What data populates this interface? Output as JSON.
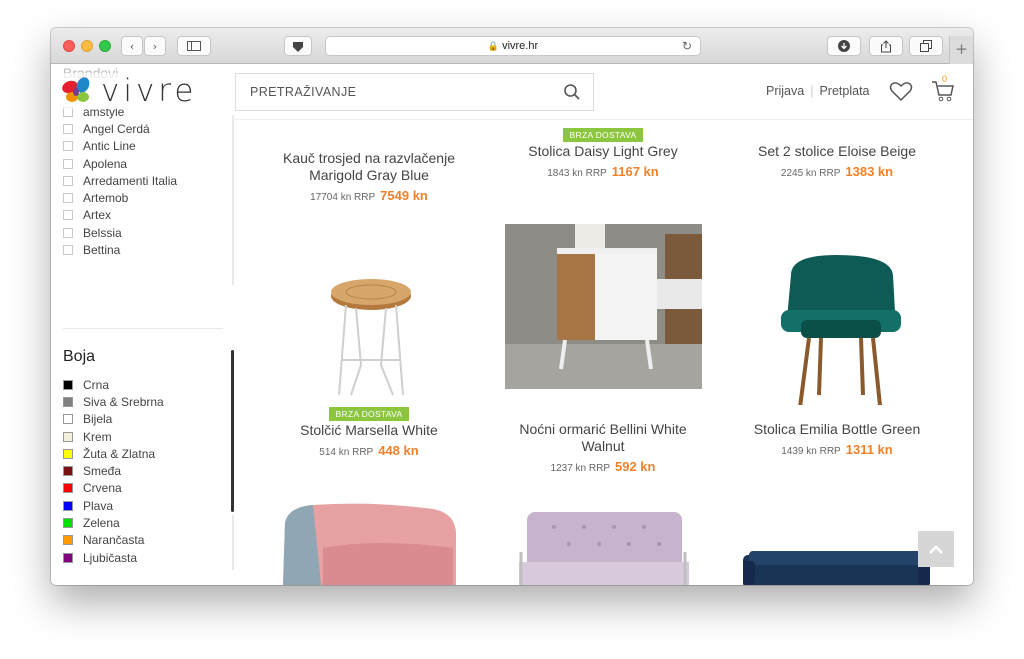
{
  "browser": {
    "url": "vivre.hr",
    "nav_back": "‹",
    "nav_forward": "›"
  },
  "site": {
    "logo_text": "vivre",
    "search_placeholder": "PRETRAŽIVANJE",
    "login_label": "Prijava",
    "subscribe_label": "Pretplata",
    "cart_count": "0"
  },
  "sidebar": {
    "brands_title": "Brandovi",
    "brands": [
      "amstyle",
      "Angel Cerdá",
      "Antic Line",
      "Apolena",
      "Arredamenti Italia",
      "Artemob",
      "Artex",
      "Belssia",
      "Bettina"
    ],
    "color_title": "Boja",
    "colors": [
      {
        "label": "Crna",
        "hex": "#000000"
      },
      {
        "label": "Siva & Srebrna",
        "hex": "#808080"
      },
      {
        "label": "Bijela",
        "hex": "#ffffff"
      },
      {
        "label": "Krem",
        "hex": "#f4f1dc"
      },
      {
        "label": "Žuta & Zlatna",
        "hex": "#ffff00"
      },
      {
        "label": "Smeđa",
        "hex": "#7b1010"
      },
      {
        "label": "Crvena",
        "hex": "#ff0000"
      },
      {
        "label": "Plava",
        "hex": "#0000ff"
      },
      {
        "label": "Zelena",
        "hex": "#00e000"
      },
      {
        "label": "Narančasta",
        "hex": "#ff9900"
      },
      {
        "label": "Ljubičasta",
        "hex": "#800080"
      }
    ]
  },
  "products": [
    {
      "name": "Kauč trosjed na razvlačenje Marigold Gray Blue",
      "old_price": "17704 kn RRP",
      "price": "7549 kn",
      "badge": ""
    },
    {
      "name": "Stolica Daisy Light Grey",
      "old_price": "1843 kn RRP",
      "price": "1167 kn",
      "badge": "BRZA DOSTAVA"
    },
    {
      "name": "Set 2 stolice Eloise Beige",
      "old_price": "2245 kn RRP",
      "price": "1383 kn",
      "badge": ""
    },
    {
      "name": "Stolčić Marsella White",
      "old_price": "514 kn RRP",
      "price": "448 kn",
      "badge": "BRZA DOSTAVA"
    },
    {
      "name": "Noćni ormarić Bellini White Walnut",
      "old_price": "1237 kn RRP",
      "price": "592 kn",
      "badge": ""
    },
    {
      "name": "Stolica Emilia Bottle Green",
      "old_price": "1439 kn RRP",
      "price": "1311 kn",
      "badge": ""
    }
  ],
  "icons": {
    "search": "search-icon",
    "wishlist": "heart-icon",
    "cart": "cart-icon",
    "back_to_top": "chevron-up-icon"
  },
  "colors": {
    "price_accent": "#f0812a",
    "badge_green": "#8cc63f"
  }
}
